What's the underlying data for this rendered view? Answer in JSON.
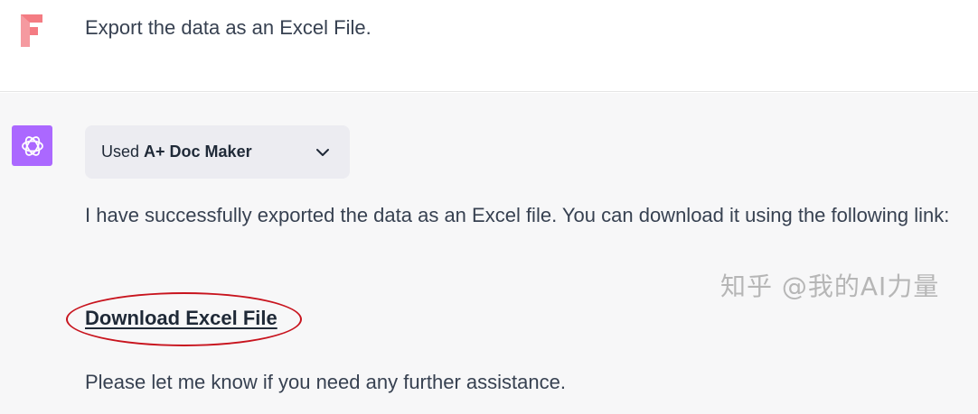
{
  "user_message": {
    "avatar_icon": "brand-logo-icon",
    "avatar_color": "#f47c83",
    "text": "Export the data as an Excel File."
  },
  "assistant_message": {
    "avatar_icon": "openai-logo-icon",
    "avatar_color": "#ab68ff",
    "plugin": {
      "used_prefix": "Used",
      "name": "A+ Doc Maker",
      "toggle_icon": "chevron-down-icon"
    },
    "body": "I have successfully exported the data as an Excel file. You can download it using the following link:",
    "download_link": "Download Excel File",
    "highlight_color": "#c8141e",
    "followup": "Please let me know if you need any further assistance."
  },
  "watermark": "知乎 @我的AI力量"
}
